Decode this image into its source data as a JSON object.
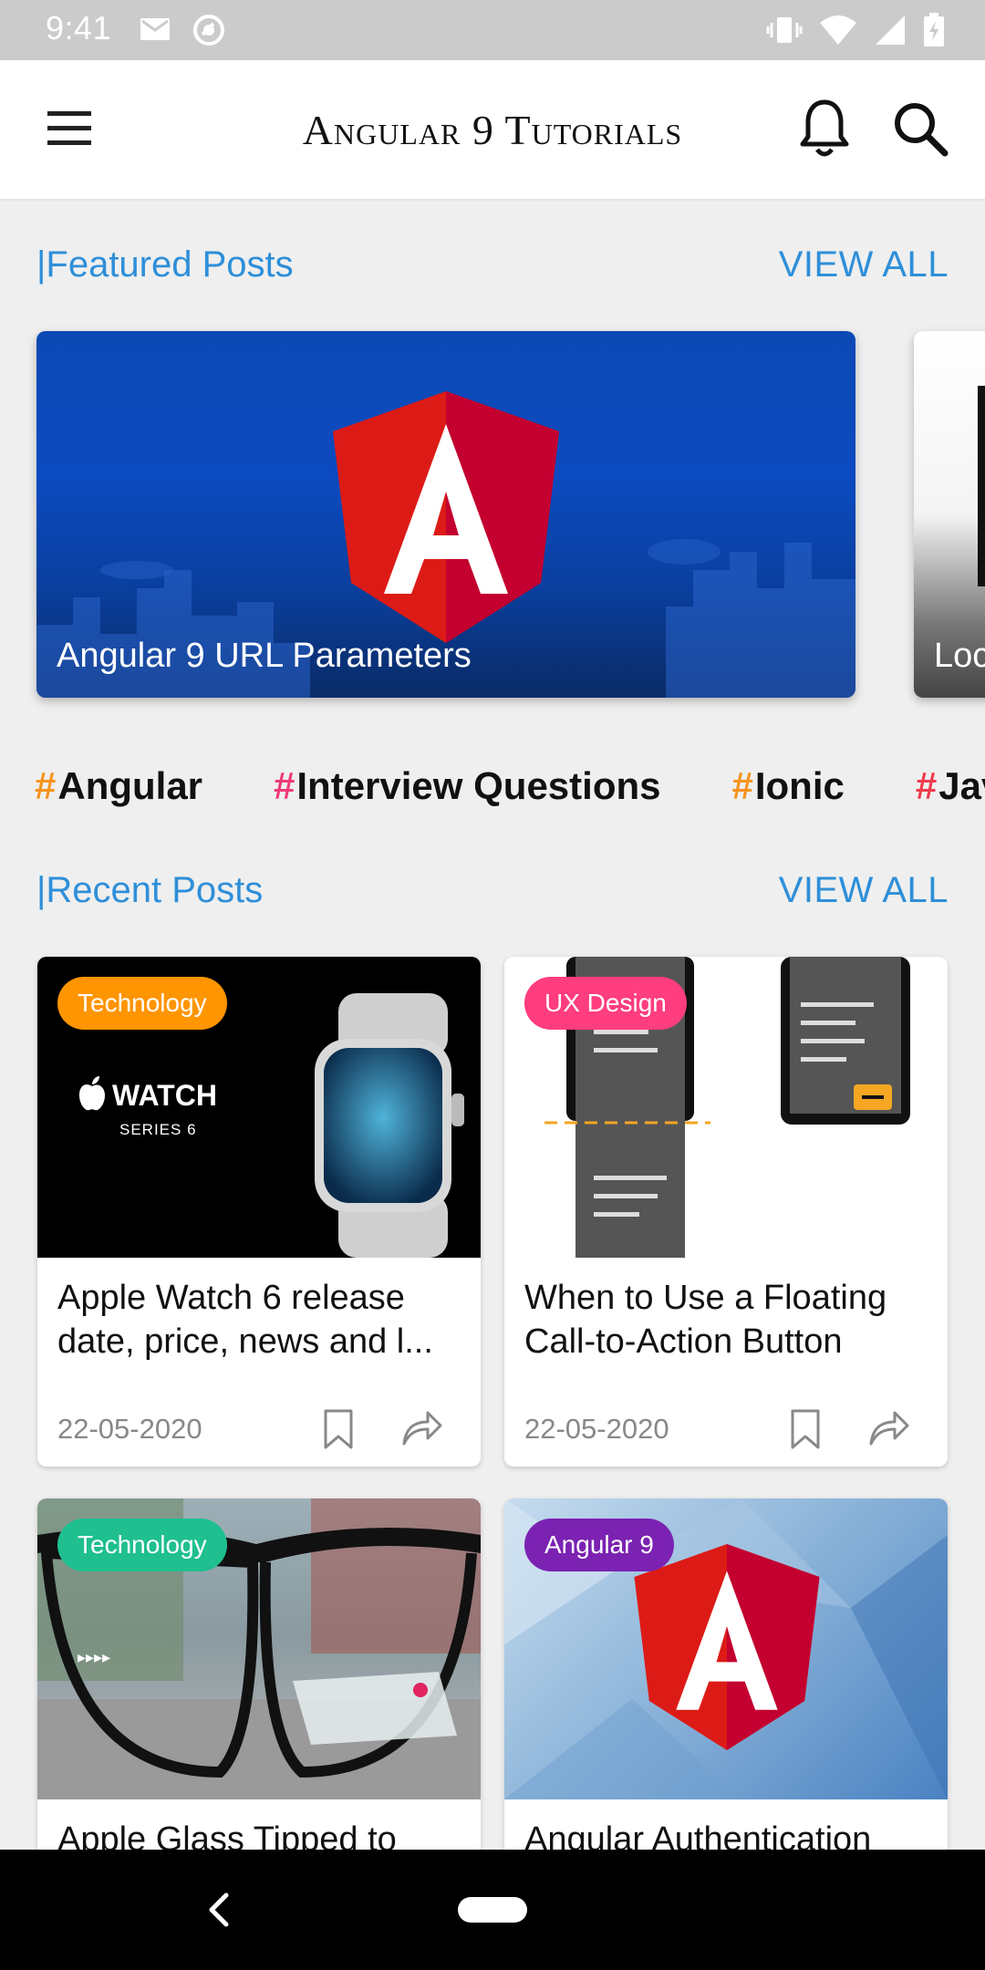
{
  "status_bar": {
    "time": "9:41",
    "left_icons": [
      "mail-icon",
      "sync-icon"
    ],
    "right_icons": [
      "vibrate-icon",
      "wifi-icon",
      "signal-icon",
      "battery-charging-icon"
    ]
  },
  "app_bar": {
    "title": "Angular 9 Tutorials",
    "menu_icon": "hamburger-menu-icon",
    "notification_icon": "bell-icon",
    "search_icon": "search-icon"
  },
  "featured": {
    "title": "|Featured Posts",
    "view_all": "VIEW ALL",
    "cards": [
      {
        "title": "Angular 9 URL Parameters"
      },
      {
        "title": "Loc"
      }
    ]
  },
  "tags": [
    {
      "hash": "#",
      "label": "Angular",
      "color": "#f7931e"
    },
    {
      "hash": "#",
      "label": "Interview Questions",
      "color": "#ef3b74"
    },
    {
      "hash": "#",
      "label": "Ionic",
      "color": "#f7931e"
    },
    {
      "hash": "#",
      "label": "Jav",
      "color": "#ef3b4b"
    }
  ],
  "recent": {
    "title": "|Recent Posts",
    "view_all": "VIEW ALL",
    "posts": [
      {
        "badge": "Technology",
        "badge_color": "#ff9500",
        "title": "Apple Watch 6 release date, price, news and l...",
        "date": "22-05-2020",
        "image_text_1": "WATCH",
        "image_text_2": "SERIES 6"
      },
      {
        "badge": "UX Design",
        "badge_color": "#ff3d7f",
        "title": "When to Use a Floating Call-to-Action Button",
        "date": "22-05-2020"
      },
      {
        "badge": "Technology",
        "badge_color": "#1fbf8f",
        "title": "Apple Glass Tipped to",
        "date": ""
      },
      {
        "badge": "Angular 9",
        "badge_color": "#7b22b2",
        "title": "Angular Authentication",
        "date": ""
      }
    ]
  },
  "colors": {
    "accent": "#2e8fd9",
    "angular_red": "#dd1b16",
    "background": "#efefef"
  }
}
